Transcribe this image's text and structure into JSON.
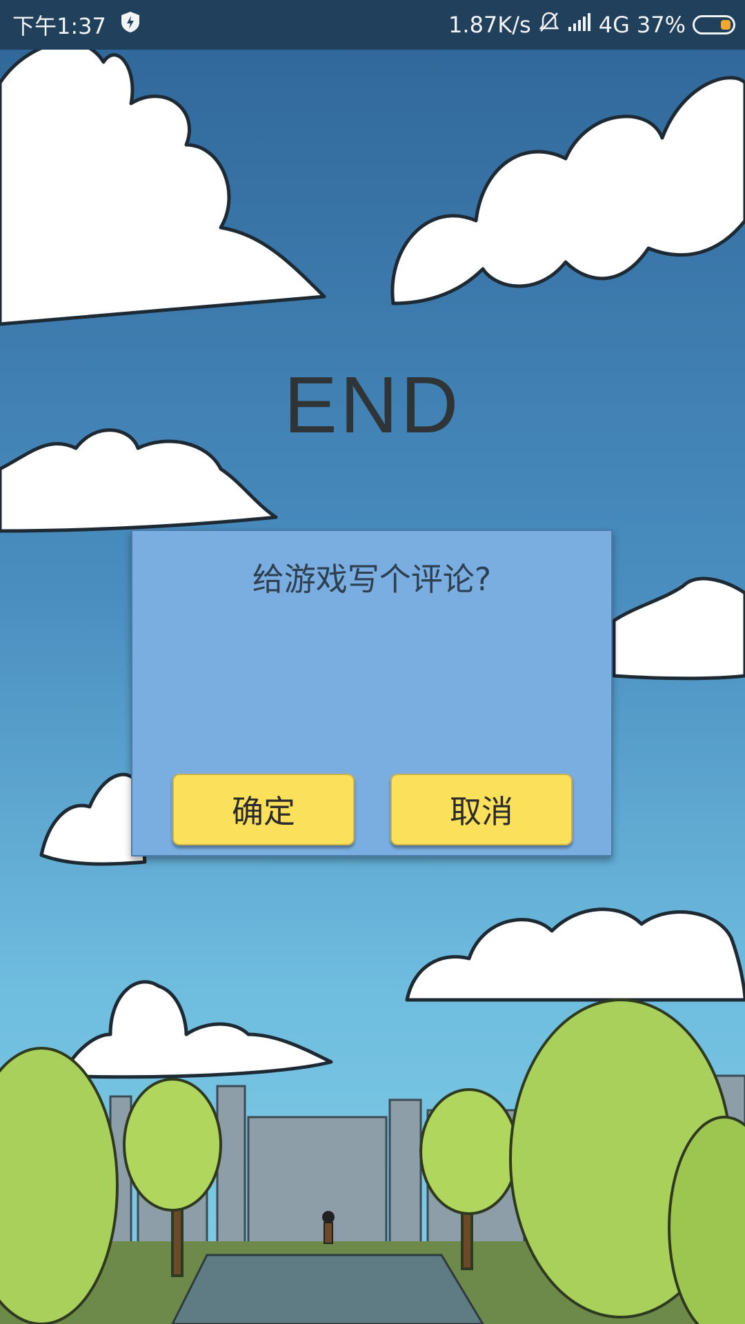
{
  "status_bar": {
    "time": "下午1:37",
    "net_speed": "1.87K/s",
    "network": "4G",
    "battery_percent": "37%",
    "battery_level": 0.37,
    "icons": [
      "shield-bolt-icon",
      "bell-off-icon",
      "signal-icon",
      "battery-icon"
    ]
  },
  "game": {
    "end_title": "END"
  },
  "dialog": {
    "title": "给游戏写个评论?",
    "confirm_label": "确定",
    "cancel_label": "取消"
  },
  "colors": {
    "dialog_bg": "#7aaee0",
    "button_bg": "#fbe05c",
    "status_bar_bg": "#21405c",
    "battery_fill": "#f0a830"
  }
}
